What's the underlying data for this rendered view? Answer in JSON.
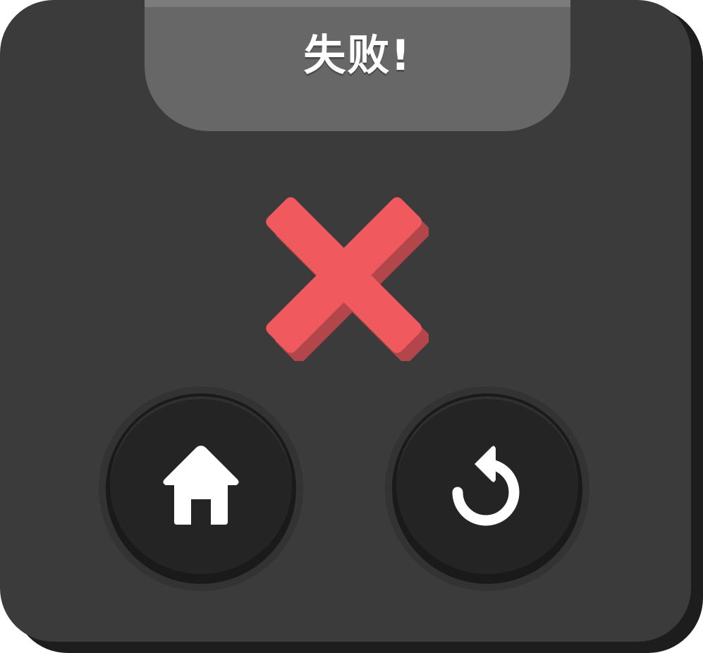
{
  "dialog": {
    "title": "失败!",
    "result_icon": "cross-icon",
    "colors": {
      "panel": "#3b3b3b",
      "title_tab": "#676767",
      "cross": "#f05a5e",
      "button": "#242424"
    }
  },
  "buttons": {
    "home": {
      "icon": "home-icon"
    },
    "retry": {
      "icon": "retry-icon"
    }
  }
}
